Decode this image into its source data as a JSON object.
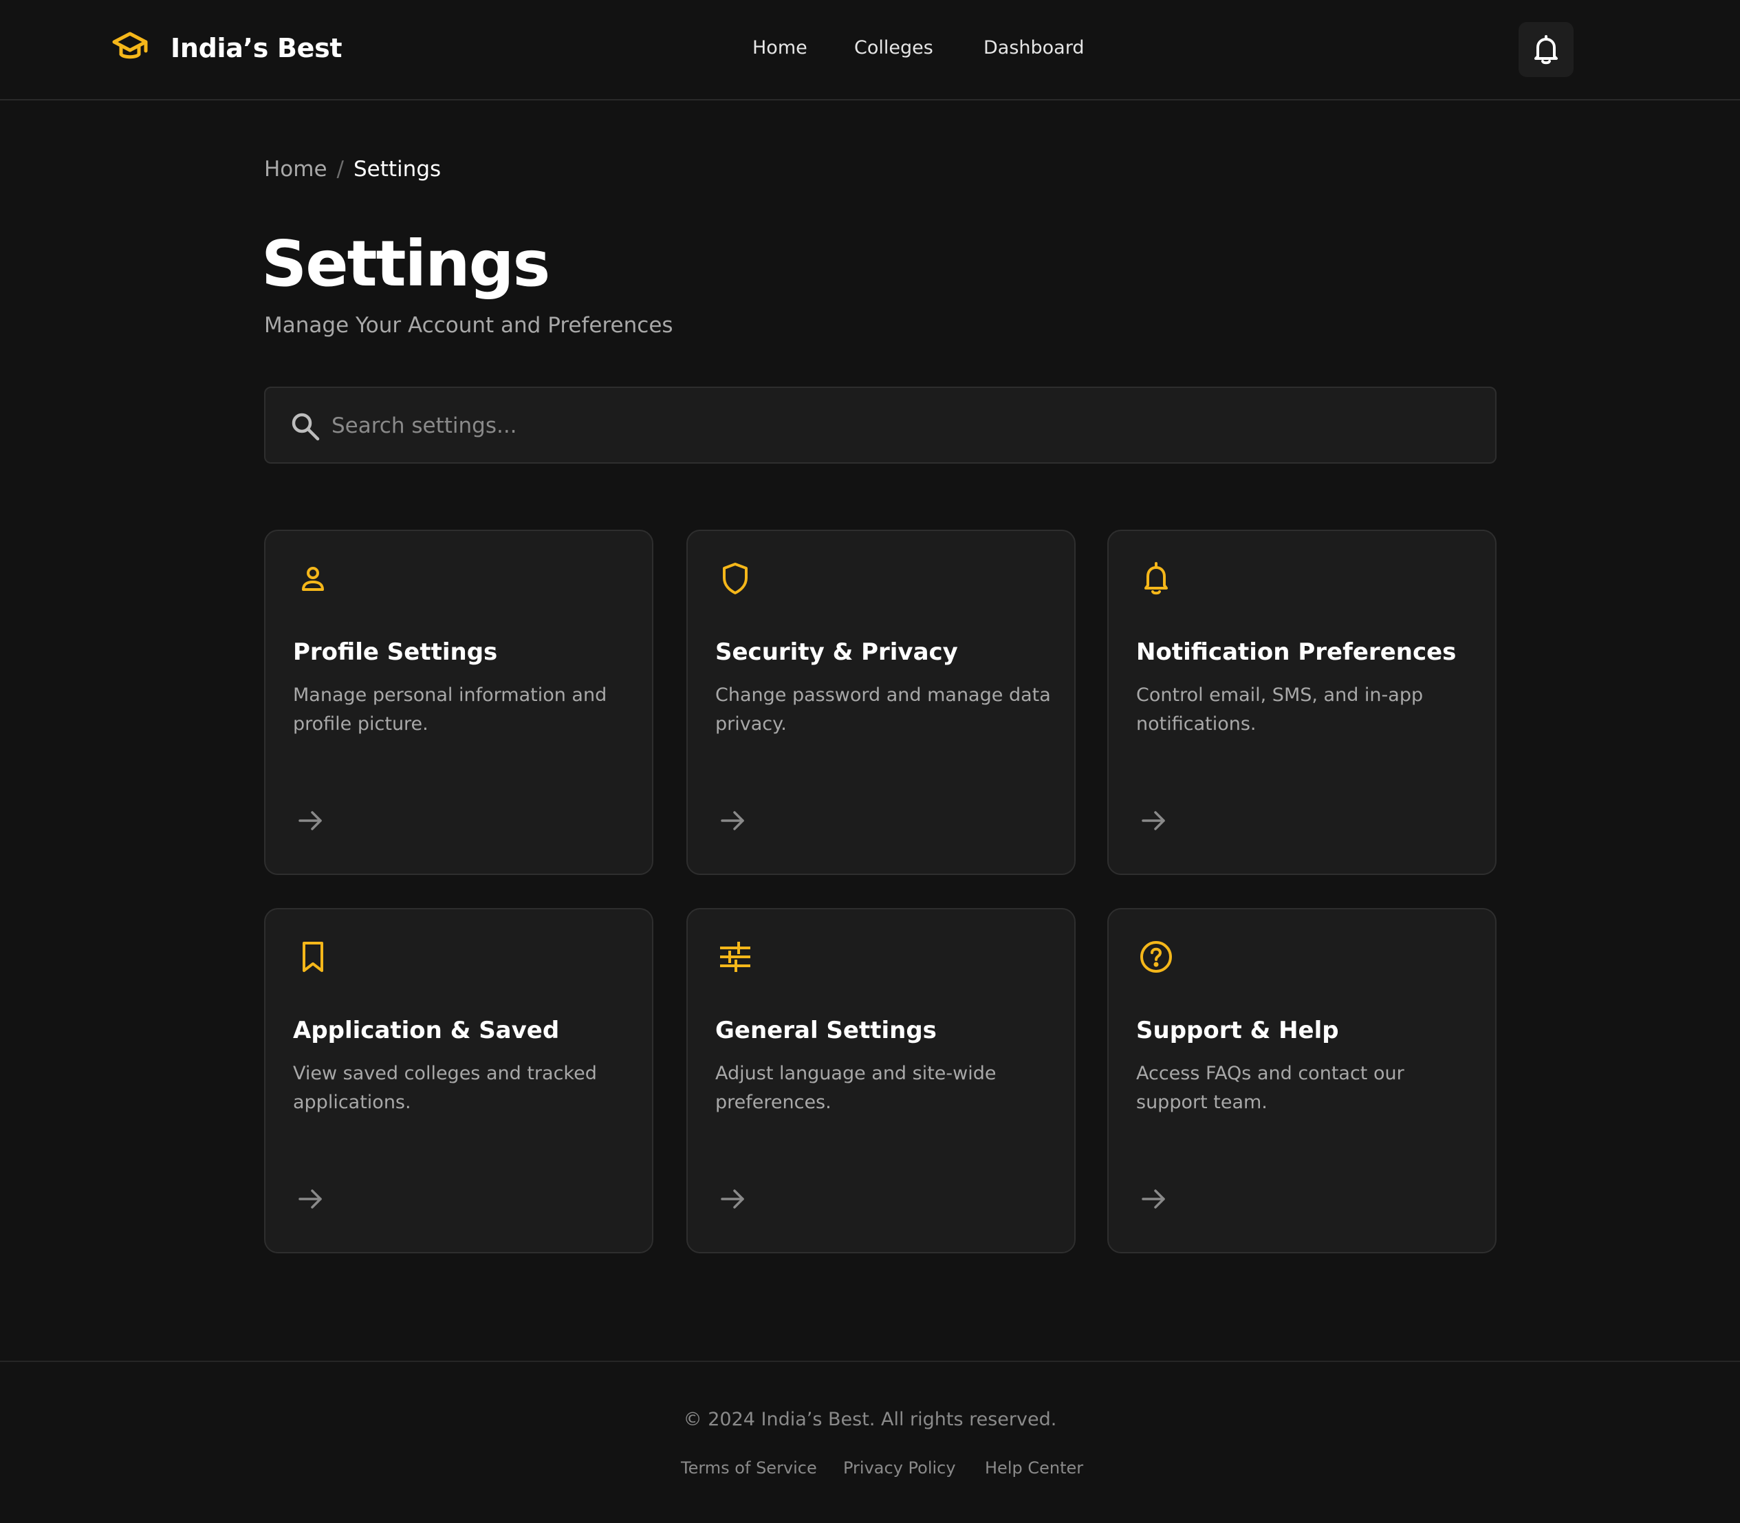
{
  "colors": {
    "background": "#121212",
    "card_background": "#1c1c1c",
    "accent": "#f5b71a",
    "text_primary": "#ffffff",
    "text_secondary": "#a8a8a8"
  },
  "header": {
    "logo_icon": "graduation-cap-icon",
    "brand": "India’s Best",
    "nav": [
      "Home",
      "Colleges",
      "Dashboard"
    ],
    "notification_icon": "bell-icon"
  },
  "breadcrumb": {
    "home": "Home",
    "separator": "/",
    "current": "Settings"
  },
  "page": {
    "title": "Settings",
    "subtitle": "Manage Your Account and Preferences"
  },
  "search": {
    "icon": "search-icon",
    "placeholder": "Search settings...",
    "value": ""
  },
  "cards": [
    {
      "icon": "user-icon",
      "title": "Profile Settings",
      "description": "Manage personal information and profile picture."
    },
    {
      "icon": "shield-icon",
      "title": "Security & Privacy",
      "description": "Change password and manage data privacy."
    },
    {
      "icon": "bell-icon",
      "title": "Notification Preferences",
      "description": "Control email, SMS, and in-app notifications."
    },
    {
      "icon": "bookmark-icon",
      "title": "Application & Saved",
      "description": "View saved colleges and tracked applications."
    },
    {
      "icon": "sliders-icon",
      "title": "General Settings",
      "description": "Adjust language and site-wide preferences."
    },
    {
      "icon": "help-circle-icon",
      "title": "Support & Help",
      "description": "Access FAQs and contact our support team."
    }
  ],
  "footer": {
    "copyright": "© 2024 India’s Best. All rights reserved.",
    "links": [
      "Terms of Service",
      "Privacy Policy",
      "Help Center"
    ]
  }
}
